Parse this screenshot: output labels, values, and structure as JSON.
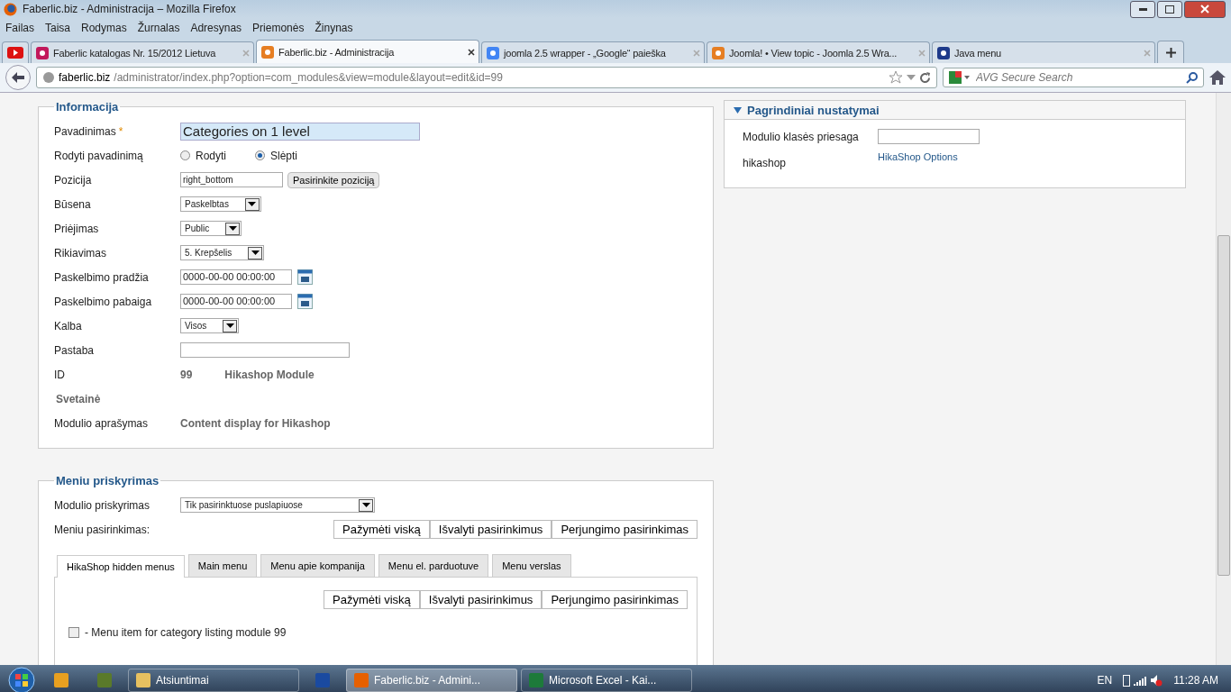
{
  "window": {
    "title": "Faberlic.biz - Administracija – Mozilla Firefox"
  },
  "menu_bar": [
    "Failas",
    "Taisa",
    "Rodymas",
    "Žurnalas",
    "Adresynas",
    "Priemonės",
    "Žinynas"
  ],
  "browser_tabs": [
    {
      "kind": "pinned",
      "selected": false
    },
    {
      "kind": "page",
      "title": "Faberlic katalogas Nr. 15/2012 Lietuva",
      "selected": false
    },
    {
      "kind": "page",
      "title": "Faberlic.biz - Administracija",
      "selected": true
    },
    {
      "kind": "page",
      "title": "joomla 2.5 wrapper - „Google“ paieška",
      "selected": false
    },
    {
      "kind": "page",
      "title": "Joomla! • View topic - Joomla 2.5 Wra...",
      "selected": false
    },
    {
      "kind": "page",
      "title": "Java menu",
      "selected": false
    }
  ],
  "address_bar": {
    "host": "faberlic.biz",
    "path": "/administrator/index.php?option=com_modules&view=module&layout=edit&id=99"
  },
  "search_bar": {
    "placeholder": "AVG Secure Search"
  },
  "info_panel": {
    "title": "Informacija",
    "rows": [
      {
        "kind": "text",
        "label": "Pavadinimas",
        "required_mark": "*",
        "value": "Categories on 1 level"
      },
      {
        "kind": "radio",
        "label": "Rodyti pavadinimą",
        "options": [
          {
            "label": "Rodyti",
            "selected": false
          },
          {
            "label": "Slėpti",
            "selected": true
          }
        ]
      },
      {
        "kind": "position",
        "label": "Pozicija",
        "value": "right_bottom",
        "button": "Pasirinkite poziciją"
      },
      {
        "kind": "select",
        "label": "Būsena",
        "value": "Paskelbtas"
      },
      {
        "kind": "select",
        "label": "Priėjimas",
        "value": "Public"
      },
      {
        "kind": "select",
        "label": "Rikiavimas",
        "value": "5. Krepšelis"
      },
      {
        "kind": "date",
        "label": "Paskelbimo pradžia",
        "value": "0000-00-00 00:00:00"
      },
      {
        "kind": "date",
        "label": "Paskelbimo pabaiga",
        "value": "0000-00-00 00:00:00"
      },
      {
        "kind": "select",
        "label": "Kalba",
        "value": "Visos"
      },
      {
        "kind": "input",
        "label": "Pastaba"
      },
      {
        "kind": "static",
        "label": "ID",
        "value": "99",
        "extra": "Hikashop Module"
      },
      {
        "kind": "heading",
        "label": "Svetainė"
      },
      {
        "kind": "static",
        "label": "Modulio aprašymas",
        "value": "Content display for Hikashop"
      }
    ]
  },
  "settings_panel": {
    "title": "Pagrindiniai nustatymai",
    "expanded": true,
    "suffix_label": "Modulio klasės priesaga",
    "hikashop_label": "hikashop",
    "hikashop_link": "HikaShop Options"
  },
  "menu_panel": {
    "title": "Meniu priskyrimas",
    "assignment_label": "Modulio priskyrimas",
    "assignment_value": "Tik pasirinktuose puslapiuose",
    "selection_label": "Meniu pasirinkimas:",
    "buttons": [
      "Pažymėti viską",
      "Išvalyti pasirinkimus",
      "Perjungimo pasirinkimas"
    ],
    "tabs": [
      {
        "label": "HikaShop hidden menus",
        "selected": true
      },
      {
        "label": "Main menu",
        "selected": false
      },
      {
        "label": "Menu apie kompanija",
        "selected": false
      },
      {
        "label": "Menu el. parduotuve",
        "selected": false
      },
      {
        "label": "Menu verslas",
        "selected": false
      }
    ],
    "tab_buttons": [
      "Pažymėti viską",
      "Išvalyti pasirinkimus",
      "Perjungimo pasirinkimas"
    ],
    "items": [
      {
        "label": "- Menu item for category listing module 99",
        "checked": false
      }
    ]
  },
  "taskbar": {
    "buttons": [
      {
        "kind": "icon",
        "selected": false
      },
      {
        "kind": "icon",
        "selected": false
      },
      {
        "kind": "window",
        "label": "Atsiuntimai",
        "selected": false
      },
      {
        "kind": "icon",
        "selected": false
      },
      {
        "kind": "window",
        "label": "Faberlic.biz - Admini...",
        "selected": true
      },
      {
        "kind": "window",
        "label": "Microsoft Excel - Kai...",
        "selected": false
      }
    ],
    "language": "EN",
    "time": "11:28 AM"
  }
}
